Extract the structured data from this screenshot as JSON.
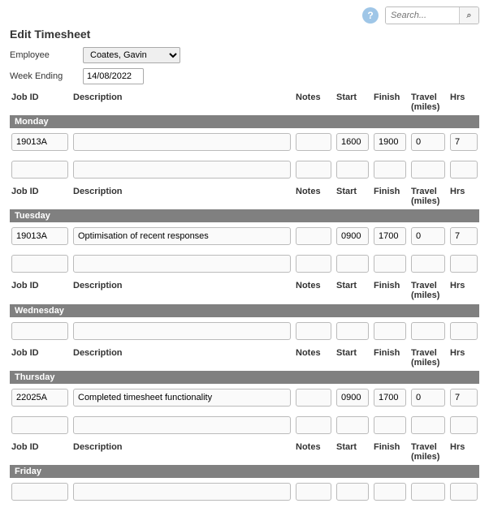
{
  "topbar": {
    "help_glyph": "?",
    "search_placeholder": "Search...",
    "search_glyph": "⌕"
  },
  "page_title": "Edit Timesheet",
  "form": {
    "employee_label": "Employee",
    "employee_value": "Coates, Gavin",
    "week_ending_label": "Week Ending",
    "week_ending_value": "14/08/2022"
  },
  "columns": {
    "job": "Job ID",
    "desc": "Description",
    "notes": "Notes",
    "start": "Start",
    "finish": "Finish",
    "travel": "Travel (miles)",
    "hrs": "Hrs"
  },
  "days": {
    "mon": {
      "label": "Monday",
      "rows": [
        {
          "job": "19013A",
          "desc": "",
          "notes": "",
          "start": "1600",
          "finish": "1900",
          "travel": "0",
          "hrs": "7"
        },
        {
          "job": "",
          "desc": "",
          "notes": "",
          "start": "",
          "finish": "",
          "travel": "",
          "hrs": ""
        }
      ]
    },
    "tue": {
      "label": "Tuesday",
      "rows": [
        {
          "job": "19013A",
          "desc": "Optimisation of recent responses",
          "notes": "",
          "start": "0900",
          "finish": "1700",
          "travel": "0",
          "hrs": "7"
        },
        {
          "job": "",
          "desc": "",
          "notes": "",
          "start": "",
          "finish": "",
          "travel": "",
          "hrs": ""
        }
      ]
    },
    "wed": {
      "label": "Wednesday",
      "rows": [
        {
          "job": "",
          "desc": "",
          "notes": "",
          "start": "",
          "finish": "",
          "travel": "",
          "hrs": ""
        }
      ]
    },
    "thu": {
      "label": "Thursday",
      "rows": [
        {
          "job": "22025A",
          "desc": "Completed timesheet functionality",
          "notes": "",
          "start": "0900",
          "finish": "1700",
          "travel": "0",
          "hrs": "7"
        },
        {
          "job": "",
          "desc": "",
          "notes": "",
          "start": "",
          "finish": "",
          "travel": "",
          "hrs": ""
        }
      ]
    },
    "fri": {
      "label": "Friday",
      "rows": [
        {
          "job": "",
          "desc": "",
          "notes": "",
          "start": "",
          "finish": "",
          "travel": "",
          "hrs": ""
        }
      ]
    }
  }
}
